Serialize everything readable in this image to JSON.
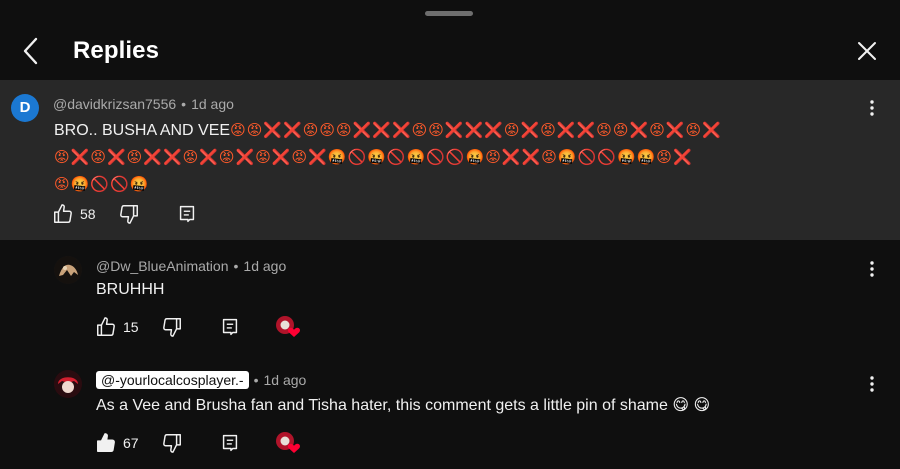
{
  "header": {
    "title": "Replies"
  },
  "root_comment": {
    "avatar_letter": "D",
    "author": "@davidkrizsan7556",
    "time": "1d ago",
    "text_prefix": "BRO.. BUSHA AND VEE",
    "emoji_line1": "😡😡❌❌😡😡😡❌❌❌😡😡❌❌❌😡❌😡❌❌😡😡❌😡❌😡❌",
    "emoji_line2": "😡❌😡❌😡❌❌😡❌😡❌😡❌😡❌🤬🚫🤬🚫🤬🚫🚫🤬😡❌❌😡🤬🚫🚫🤬🤬😡❌",
    "emoji_line3": "😡🤬🚫🚫🤬",
    "likes": "58"
  },
  "replies": [
    {
      "author": "@Dw_BlueAnimation",
      "time": "1d ago",
      "text": "BRUHHH",
      "likes": "15",
      "author_chip": false
    },
    {
      "author": "@-yourlocalcosplayer.-",
      "time": "1d ago",
      "text": "As a Vee and Brusha fan and Tisha hater, this comment gets a little pin of shame 😋 😋",
      "likes": "67",
      "author_chip": true
    }
  ],
  "icons": {
    "back": "chevron-left-icon",
    "close": "close-icon",
    "like": "thumbs-up-icon",
    "dislike": "thumbs-down-icon",
    "reply": "reply-icon",
    "more": "more-vert-icon",
    "heart": "creator-heart-icon"
  },
  "colors": {
    "background": "#0f0f0f",
    "highlight": "#282828",
    "meta_text": "#aaaaaa",
    "avatar_d": "#1b78d2",
    "heart": "#ff0033"
  }
}
